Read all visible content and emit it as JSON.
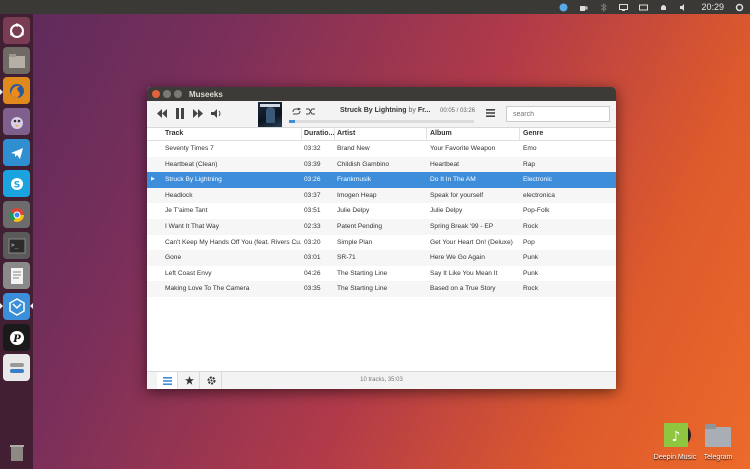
{
  "top_panel": {
    "clock": "20:29",
    "indicators": [
      "blue-circle-icon",
      "coffee-cup-icon",
      "bluetooth-icon",
      "screen-icon",
      "keyboard-icon",
      "bell-icon",
      "volume-icon",
      "gear-icon"
    ]
  },
  "launcher": {
    "items": [
      "ubuntu-logo-icon",
      "files-icon",
      "firefox-icon",
      "pidgin-icon",
      "telegram-icon",
      "skype-icon",
      "chrome-icon",
      "terminal-icon",
      "text-editor-icon",
      "museeks-icon",
      "pocket-icon",
      "settings-toggle-icon",
      "trash-icon"
    ]
  },
  "desktop": {
    "icons": [
      {
        "label": "Deepin Music",
        "icon": "deepin-music-icon"
      },
      {
        "label": "Telegram",
        "icon": "folder-icon"
      }
    ]
  },
  "window": {
    "title": "Museeks",
    "now_playing": {
      "title": "Struck By Lightning",
      "by": "by",
      "artist": "Fr...",
      "time": "00:05 / 03:26",
      "progress": 0.03
    },
    "search_placeholder": "search",
    "columns": [
      "Track",
      "Duratio...",
      "Artist",
      "Album",
      "Genre"
    ],
    "tracks": [
      {
        "track": "Seventy Times 7",
        "duration": "03:32",
        "artist": "Brand New",
        "album": "Your Favorite Weapon",
        "genre": "Emo"
      },
      {
        "track": "Heartbeat (Clean)",
        "duration": "03:39",
        "artist": "Childish Gambino",
        "album": "Heartbeat",
        "genre": "Rap"
      },
      {
        "track": "Struck By Lightning",
        "duration": "03:26",
        "artist": "Frankmusik",
        "album": "Do It In The AM",
        "genre": "Electronic"
      },
      {
        "track": "Headlock",
        "duration": "03:37",
        "artist": "Imogen Heap",
        "album": "Speak for yourself",
        "genre": "electronica"
      },
      {
        "track": "Je T'aime Tant",
        "duration": "03:51",
        "artist": "Julie Delpy",
        "album": "Julie Delpy",
        "genre": "Pop-Folk"
      },
      {
        "track": "I Want It That Way",
        "duration": "02:33",
        "artist": "Patent Pending",
        "album": "Spring Break '99 - EP",
        "genre": "Rock"
      },
      {
        "track": "Can't Keep My Hands Off You (feat. Rivers Cu...",
        "duration": "03:20",
        "artist": "Simple Plan",
        "album": "Get Your Heart On! (Deluxe)",
        "genre": "Pop"
      },
      {
        "track": "Gone",
        "duration": "03:01",
        "artist": "SR-71",
        "album": "Here We Go Again",
        "genre": "Punk"
      },
      {
        "track": "Left Coast Envy",
        "duration": "04:26",
        "artist": "The Starting Line",
        "album": "Say It Like You Mean It",
        "genre": "Punk"
      },
      {
        "track": "Making Love To The Camera",
        "duration": "03:35",
        "artist": "The Starting Line",
        "album": "Based on a True Story",
        "genre": "Rock"
      }
    ],
    "footer_status": "10 tracks, 35:03"
  },
  "colors": {
    "accent": "#3d8ddb",
    "titlebar": "#3c3b37"
  }
}
